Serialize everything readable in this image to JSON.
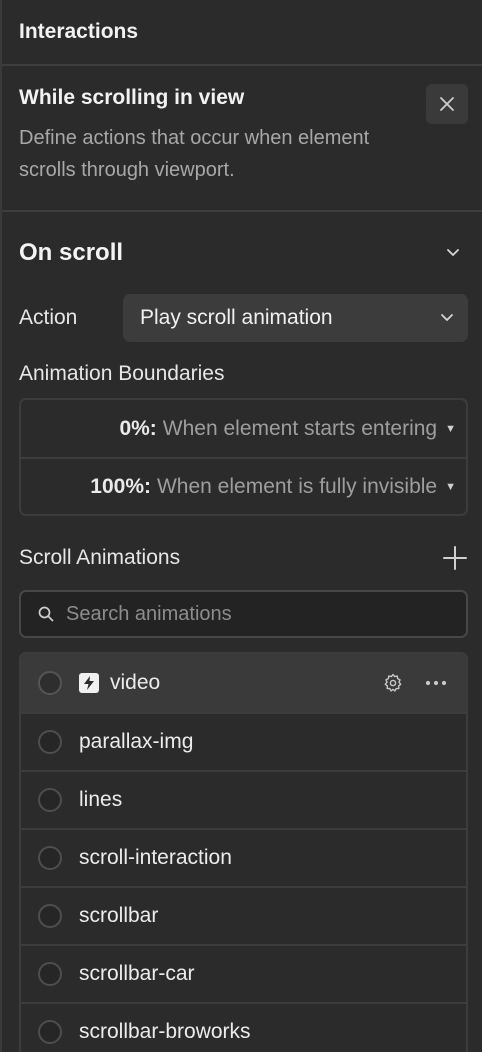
{
  "panel": {
    "title": "Interactions"
  },
  "trigger": {
    "title": "While scrolling in view",
    "description": "Define actions that occur when element scrolls through viewport.",
    "close_icon": "close-icon"
  },
  "on_scroll": {
    "title": "On scroll",
    "chevron_icon": "chevron-down-icon"
  },
  "action": {
    "label": "Action",
    "value": "Play scroll animation"
  },
  "boundaries": {
    "label": "Animation Boundaries",
    "rows": [
      {
        "percent": "0%:",
        "text": "When element starts entering"
      },
      {
        "percent": "100%:",
        "text": "When element is fully invisible"
      }
    ]
  },
  "scroll_animations": {
    "label": "Scroll Animations",
    "add_icon": "plus-icon",
    "search_placeholder": "Search animations",
    "items": [
      {
        "name": "video",
        "selected": true
      },
      {
        "name": "parallax-img"
      },
      {
        "name": "lines"
      },
      {
        "name": "scroll-interaction"
      },
      {
        "name": "scrollbar"
      },
      {
        "name": "scrollbar-car"
      },
      {
        "name": "scrollbar-broworks"
      }
    ]
  },
  "colors": {
    "background": "#2b2b2b",
    "surface": "#3a3a3a",
    "text": "#e8e8e8",
    "muted": "#a8a8a8"
  }
}
